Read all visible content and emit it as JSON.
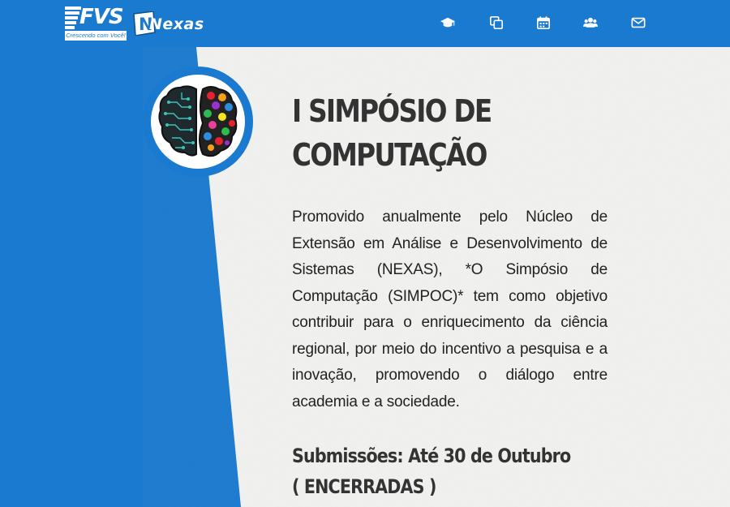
{
  "header": {
    "logo_fvs": {
      "text": "FVS",
      "tagline": "Crescendo com Você!"
    },
    "logo_nexas": {
      "text": "Nexas"
    },
    "nav": [
      {
        "icon": "graduation-cap-icon"
      },
      {
        "icon": "copy-pages-icon"
      },
      {
        "icon": "calendar-icon"
      },
      {
        "icon": "users-icon"
      },
      {
        "icon": "envelope-icon"
      }
    ]
  },
  "hero": {
    "image": "brain-icon",
    "title": "I SIMPÓSIO DE COMPUTAÇÃO",
    "description": "Promovido anualmente pelo Núcleo de Extensão em Análise e Desenvolvimento de Sistemas (NEXAS), *O Simpósio de Computação (SIMPOC)* tem como objetivo contribuir para o enriquecimento da ciência regional, por meio do incentivo a pesquisa e a inovação, promovendo o diálogo entre academia e a sociedade.",
    "submissions": "Submissões: Até 30 de Outubro ( ENCERRADAS )"
  },
  "colors": {
    "brand_blue": "#1a7ad0",
    "paper": "#f1f1ef",
    "text": "#333333"
  }
}
